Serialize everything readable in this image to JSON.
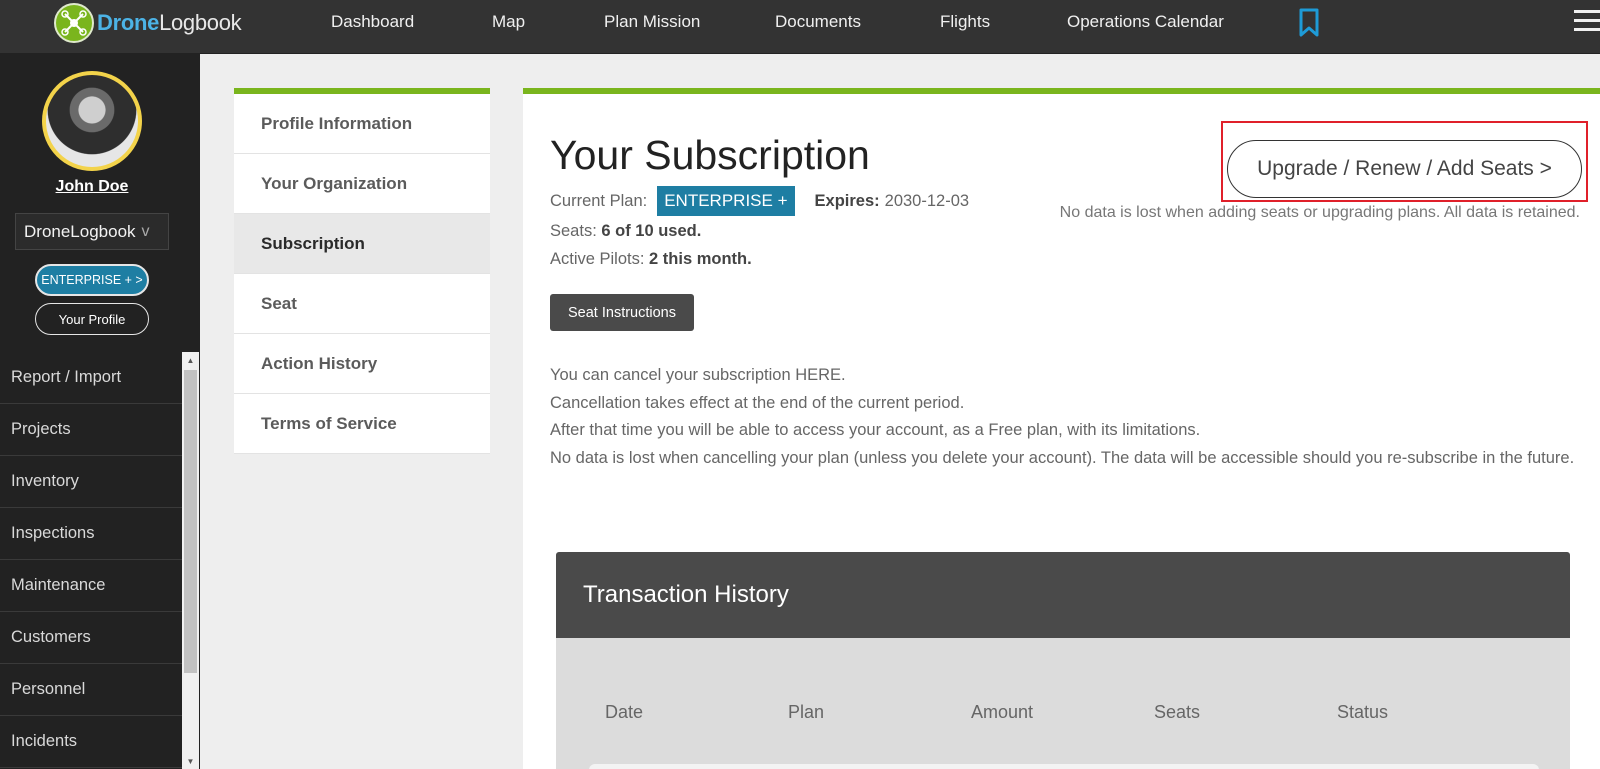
{
  "brand": {
    "part1": "Drone",
    "part2": "Logbook"
  },
  "topnav": {
    "items": [
      "Dashboard",
      "Map",
      "Plan Mission",
      "Documents",
      "Flights",
      "Operations Calendar"
    ]
  },
  "sidebar": {
    "user_name": "John Doe",
    "organization": "DroneLogbook",
    "org_chevron": "v",
    "plan_button": "ENTERPRISE + >",
    "profile_button": "Your Profile",
    "menu": [
      "Report / Import",
      "Projects",
      "Inventory",
      "Inspections",
      "Maintenance",
      "Customers",
      "Personnel",
      "Incidents"
    ]
  },
  "settings_tabs": {
    "items": [
      "Profile Information",
      "Your Organization",
      "Subscription",
      "Seat",
      "Action History",
      "Terms of Service"
    ],
    "active": "Subscription"
  },
  "subscription": {
    "title": "Your Subscription",
    "current_plan_label": "Current Plan:",
    "current_plan": "ENTERPRISE +",
    "expires_label": "Expires:",
    "expires_value": "2030-12-03",
    "seats_label": "Seats:",
    "seats_value": "6 of 10 used.",
    "pilots_label": "Active Pilots:",
    "pilots_value": "2 this month.",
    "seat_instructions_button": "Seat Instructions",
    "upgrade_button": "Upgrade / Renew / Add Seats >",
    "retain_note": "No data is lost when adding seats or upgrading plans. All data is retained.",
    "cancel_lines": [
      "You can cancel your subscription HERE.",
      "Cancellation takes effect at the end of the current period.",
      "After that time you will be able to access your account, as a Free plan, with its limitations.",
      "No data is lost when cancelling your plan (unless you delete your account). The data will be accessible should you re-subscribe in the future."
    ]
  },
  "transactions": {
    "title": "Transaction History",
    "columns": [
      "Date",
      "Plan",
      "Amount",
      "Seats",
      "Status"
    ]
  },
  "colors": {
    "accent_green": "#7ab51d",
    "plan_blue": "#1e7ea3",
    "highlight_red": "#e0202a",
    "topbar": "#333333"
  }
}
